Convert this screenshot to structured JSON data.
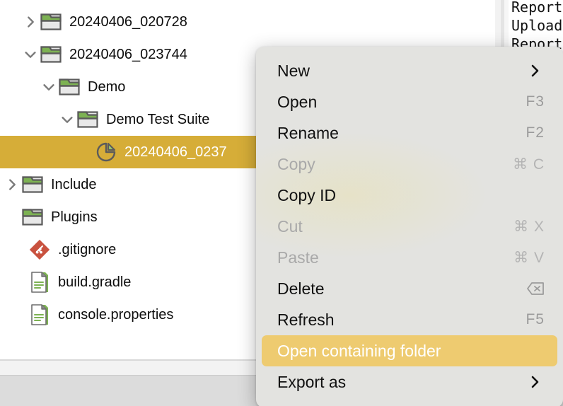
{
  "tree": {
    "rows": [
      {
        "label": "20240406_020728",
        "icon": "folder-icon",
        "twisty": "chevron-right",
        "indent": 30,
        "selected": false
      },
      {
        "label": "20240406_023744",
        "icon": "folder-icon",
        "twisty": "chevron-down",
        "indent": 30,
        "selected": false
      },
      {
        "label": "Demo",
        "icon": "folder-icon",
        "twisty": "chevron-down",
        "indent": 56,
        "selected": false
      },
      {
        "label": "Demo Test Suite",
        "icon": "folder-icon",
        "twisty": "chevron-down",
        "indent": 82,
        "selected": false
      },
      {
        "label": "20240406_0237",
        "icon": "pie-chart-icon",
        "twisty": "none",
        "indent": 108,
        "selected": true
      },
      {
        "label": "Include",
        "icon": "folder-icon",
        "twisty": "chevron-right",
        "indent": 4,
        "selected": false
      },
      {
        "label": "Plugins",
        "icon": "folder-icon",
        "twisty": "none",
        "indent": 4,
        "selected": false
      },
      {
        "label": ".gitignore",
        "icon": "git-file-icon",
        "twisty": "none",
        "indent": 14,
        "selected": false
      },
      {
        "label": "build.gradle",
        "icon": "text-file-icon",
        "twisty": "none",
        "indent": 14,
        "selected": false
      },
      {
        "label": "console.properties",
        "icon": "text-file-icon",
        "twisty": "none",
        "indent": 14,
        "selected": false
      }
    ]
  },
  "log_panel": {
    "lines": [
      "Report",
      "Upload",
      "Report"
    ]
  },
  "context_menu": {
    "items": [
      {
        "label": "New",
        "accel": "",
        "submenu": true,
        "disabled": false,
        "highlight": false,
        "glyph": ""
      },
      {
        "label": "Open",
        "accel": "F3",
        "submenu": false,
        "disabled": false,
        "highlight": false,
        "glyph": ""
      },
      {
        "label": "Rename",
        "accel": "F2",
        "submenu": false,
        "disabled": false,
        "highlight": false,
        "glyph": ""
      },
      {
        "label": "Copy",
        "accel": "⌘ C",
        "submenu": false,
        "disabled": true,
        "highlight": false,
        "glyph": ""
      },
      {
        "label": "Copy ID",
        "accel": "",
        "submenu": false,
        "disabled": false,
        "highlight": false,
        "glyph": ""
      },
      {
        "label": "Cut",
        "accel": "⌘ X",
        "submenu": false,
        "disabled": true,
        "highlight": false,
        "glyph": ""
      },
      {
        "label": "Paste",
        "accel": "⌘ V",
        "submenu": false,
        "disabled": true,
        "highlight": false,
        "glyph": ""
      },
      {
        "label": "Delete",
        "accel": "",
        "submenu": false,
        "disabled": false,
        "highlight": false,
        "glyph": "delete-key-icon"
      },
      {
        "label": "Refresh",
        "accel": "F5",
        "submenu": false,
        "disabled": false,
        "highlight": false,
        "glyph": ""
      },
      {
        "label": "Open containing folder",
        "accel": "",
        "submenu": false,
        "disabled": false,
        "highlight": true,
        "glyph": ""
      },
      {
        "label": "Export as",
        "accel": "",
        "submenu": true,
        "disabled": false,
        "highlight": false,
        "glyph": ""
      }
    ]
  },
  "colors": {
    "selection": "#d6ad38",
    "menu_highlight": "#eecb70",
    "menu_background": "#e3e3e0",
    "folder_green": "#7db253",
    "git_red": "#c9523f",
    "accel_gray": "#9b9b9b"
  }
}
